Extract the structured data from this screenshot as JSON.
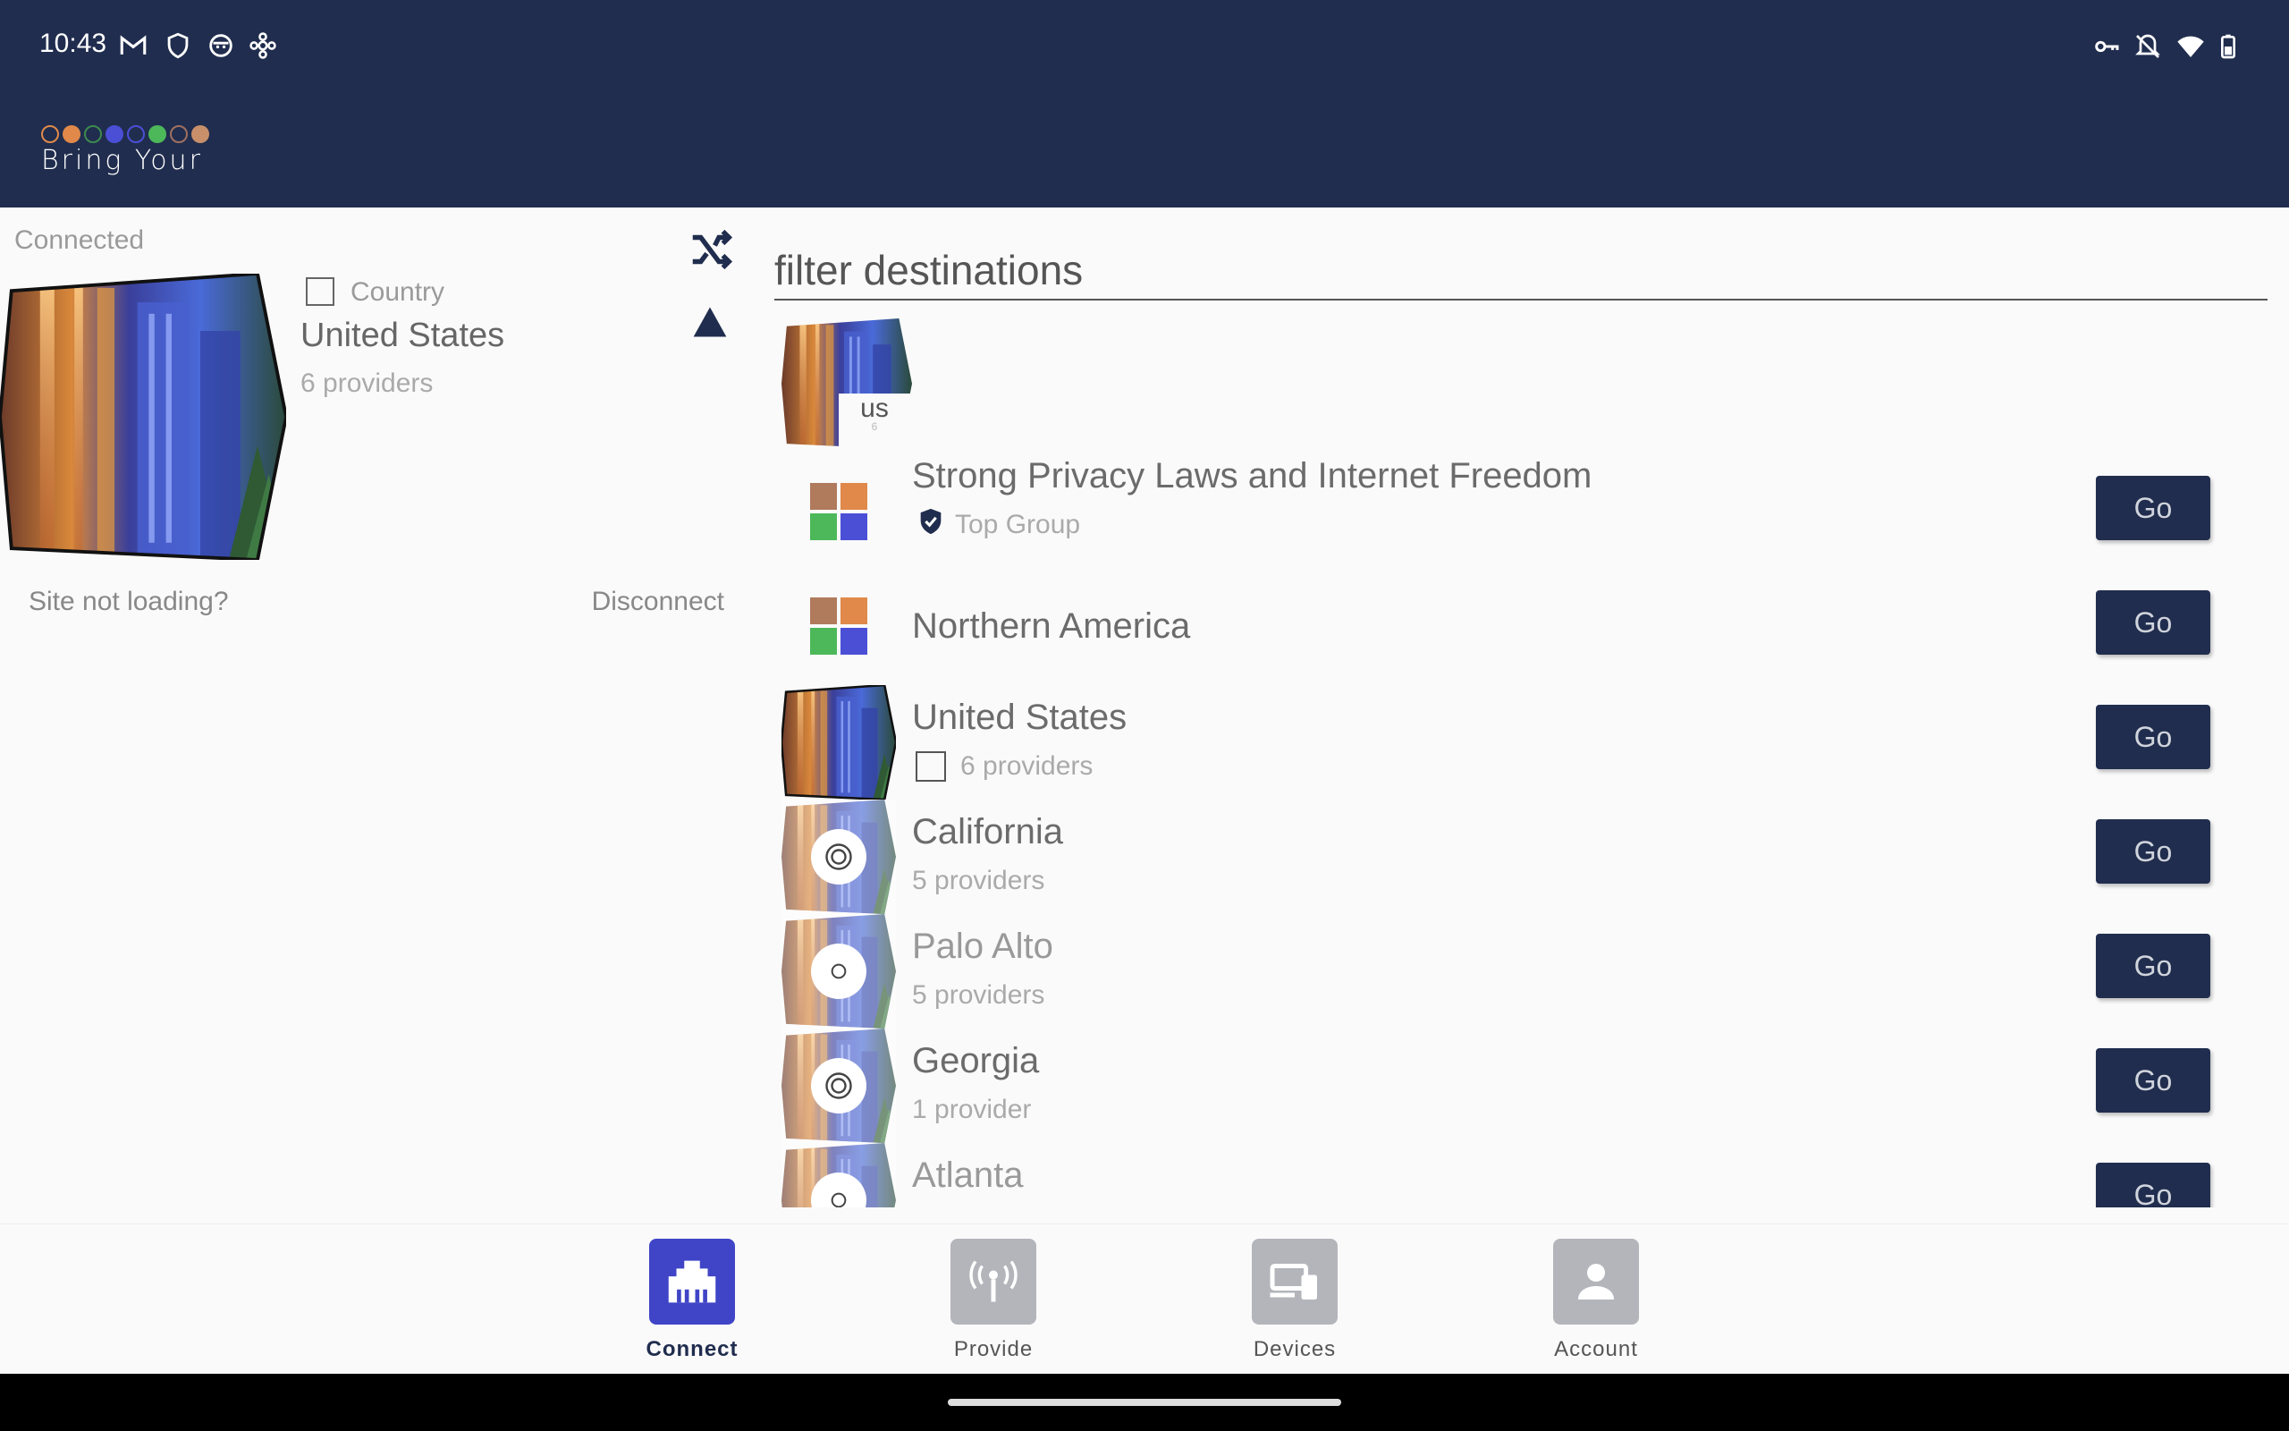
{
  "status_bar": {
    "time": "10:43",
    "left_icons": [
      "gmail-icon",
      "shield-icon",
      "face-icon",
      "network-icon"
    ],
    "right_icons": [
      "vpn-key-icon",
      "mute-icon",
      "wifi-icon",
      "battery-icon"
    ]
  },
  "header": {
    "logo_text": "Bring Your",
    "logo_dot_colors": [
      "#e0894a",
      "#e0894a",
      "#3d8b4f",
      "#4b4fd6",
      "#4b4fd6",
      "#4cb85a",
      "#a07060",
      "#c8906a"
    ]
  },
  "connection": {
    "status": "Connected",
    "type_label": "Country",
    "name": "United States",
    "providers": "6 providers",
    "site_not_loading": "Site not loading?",
    "disconnect": "Disconnect"
  },
  "filter": {
    "placeholder": "filter destinations"
  },
  "destinations": {
    "us_tile": {
      "code": "us",
      "count": "6"
    },
    "items": [
      {
        "title": "Strong Privacy Laws and Internet Freedom",
        "subtitle": "Top Group",
        "go": "Go"
      },
      {
        "title": "Northern America",
        "subtitle": "",
        "go": "Go"
      },
      {
        "title": "United States",
        "subtitle": "6 providers",
        "go": "Go"
      },
      {
        "title": "California",
        "subtitle": "5 providers",
        "go": "Go"
      },
      {
        "title": "Palo Alto",
        "subtitle": "5 providers",
        "go": "Go"
      },
      {
        "title": "Georgia",
        "subtitle": "1 provider",
        "go": "Go"
      },
      {
        "title": "Atlanta",
        "subtitle": "",
        "go": "Go"
      }
    ]
  },
  "nav": {
    "connect": "Connect",
    "provide": "Provide",
    "devices": "Devices",
    "account": "Account",
    "active_color": "#3f45c6",
    "inactive_color": "#b3b5bb"
  }
}
